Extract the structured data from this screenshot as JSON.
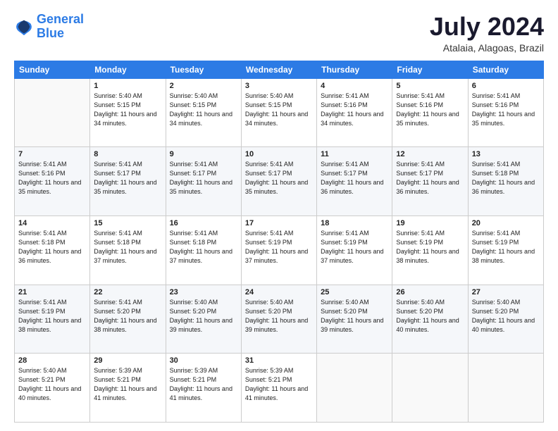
{
  "logo": {
    "line1": "General",
    "line2": "Blue"
  },
  "title": "July 2024",
  "subtitle": "Atalaia, Alagoas, Brazil",
  "days_of_week": [
    "Sunday",
    "Monday",
    "Tuesday",
    "Wednesday",
    "Thursday",
    "Friday",
    "Saturday"
  ],
  "weeks": [
    [
      {
        "day": "",
        "sunrise": "",
        "sunset": "",
        "daylight": ""
      },
      {
        "day": "1",
        "sunrise": "Sunrise: 5:40 AM",
        "sunset": "Sunset: 5:15 PM",
        "daylight": "Daylight: 11 hours and 34 minutes."
      },
      {
        "day": "2",
        "sunrise": "Sunrise: 5:40 AM",
        "sunset": "Sunset: 5:15 PM",
        "daylight": "Daylight: 11 hours and 34 minutes."
      },
      {
        "day": "3",
        "sunrise": "Sunrise: 5:40 AM",
        "sunset": "Sunset: 5:15 PM",
        "daylight": "Daylight: 11 hours and 34 minutes."
      },
      {
        "day": "4",
        "sunrise": "Sunrise: 5:41 AM",
        "sunset": "Sunset: 5:16 PM",
        "daylight": "Daylight: 11 hours and 34 minutes."
      },
      {
        "day": "5",
        "sunrise": "Sunrise: 5:41 AM",
        "sunset": "Sunset: 5:16 PM",
        "daylight": "Daylight: 11 hours and 35 minutes."
      },
      {
        "day": "6",
        "sunrise": "Sunrise: 5:41 AM",
        "sunset": "Sunset: 5:16 PM",
        "daylight": "Daylight: 11 hours and 35 minutes."
      }
    ],
    [
      {
        "day": "7",
        "sunrise": "Sunrise: 5:41 AM",
        "sunset": "Sunset: 5:16 PM",
        "daylight": "Daylight: 11 hours and 35 minutes."
      },
      {
        "day": "8",
        "sunrise": "Sunrise: 5:41 AM",
        "sunset": "Sunset: 5:17 PM",
        "daylight": "Daylight: 11 hours and 35 minutes."
      },
      {
        "day": "9",
        "sunrise": "Sunrise: 5:41 AM",
        "sunset": "Sunset: 5:17 PM",
        "daylight": "Daylight: 11 hours and 35 minutes."
      },
      {
        "day": "10",
        "sunrise": "Sunrise: 5:41 AM",
        "sunset": "Sunset: 5:17 PM",
        "daylight": "Daylight: 11 hours and 35 minutes."
      },
      {
        "day": "11",
        "sunrise": "Sunrise: 5:41 AM",
        "sunset": "Sunset: 5:17 PM",
        "daylight": "Daylight: 11 hours and 36 minutes."
      },
      {
        "day": "12",
        "sunrise": "Sunrise: 5:41 AM",
        "sunset": "Sunset: 5:17 PM",
        "daylight": "Daylight: 11 hours and 36 minutes."
      },
      {
        "day": "13",
        "sunrise": "Sunrise: 5:41 AM",
        "sunset": "Sunset: 5:18 PM",
        "daylight": "Daylight: 11 hours and 36 minutes."
      }
    ],
    [
      {
        "day": "14",
        "sunrise": "Sunrise: 5:41 AM",
        "sunset": "Sunset: 5:18 PM",
        "daylight": "Daylight: 11 hours and 36 minutes."
      },
      {
        "day": "15",
        "sunrise": "Sunrise: 5:41 AM",
        "sunset": "Sunset: 5:18 PM",
        "daylight": "Daylight: 11 hours and 37 minutes."
      },
      {
        "day": "16",
        "sunrise": "Sunrise: 5:41 AM",
        "sunset": "Sunset: 5:18 PM",
        "daylight": "Daylight: 11 hours and 37 minutes."
      },
      {
        "day": "17",
        "sunrise": "Sunrise: 5:41 AM",
        "sunset": "Sunset: 5:19 PM",
        "daylight": "Daylight: 11 hours and 37 minutes."
      },
      {
        "day": "18",
        "sunrise": "Sunrise: 5:41 AM",
        "sunset": "Sunset: 5:19 PM",
        "daylight": "Daylight: 11 hours and 37 minutes."
      },
      {
        "day": "19",
        "sunrise": "Sunrise: 5:41 AM",
        "sunset": "Sunset: 5:19 PM",
        "daylight": "Daylight: 11 hours and 38 minutes."
      },
      {
        "day": "20",
        "sunrise": "Sunrise: 5:41 AM",
        "sunset": "Sunset: 5:19 PM",
        "daylight": "Daylight: 11 hours and 38 minutes."
      }
    ],
    [
      {
        "day": "21",
        "sunrise": "Sunrise: 5:41 AM",
        "sunset": "Sunset: 5:19 PM",
        "daylight": "Daylight: 11 hours and 38 minutes."
      },
      {
        "day": "22",
        "sunrise": "Sunrise: 5:41 AM",
        "sunset": "Sunset: 5:20 PM",
        "daylight": "Daylight: 11 hours and 38 minutes."
      },
      {
        "day": "23",
        "sunrise": "Sunrise: 5:40 AM",
        "sunset": "Sunset: 5:20 PM",
        "daylight": "Daylight: 11 hours and 39 minutes."
      },
      {
        "day": "24",
        "sunrise": "Sunrise: 5:40 AM",
        "sunset": "Sunset: 5:20 PM",
        "daylight": "Daylight: 11 hours and 39 minutes."
      },
      {
        "day": "25",
        "sunrise": "Sunrise: 5:40 AM",
        "sunset": "Sunset: 5:20 PM",
        "daylight": "Daylight: 11 hours and 39 minutes."
      },
      {
        "day": "26",
        "sunrise": "Sunrise: 5:40 AM",
        "sunset": "Sunset: 5:20 PM",
        "daylight": "Daylight: 11 hours and 40 minutes."
      },
      {
        "day": "27",
        "sunrise": "Sunrise: 5:40 AM",
        "sunset": "Sunset: 5:20 PM",
        "daylight": "Daylight: 11 hours and 40 minutes."
      }
    ],
    [
      {
        "day": "28",
        "sunrise": "Sunrise: 5:40 AM",
        "sunset": "Sunset: 5:21 PM",
        "daylight": "Daylight: 11 hours and 40 minutes."
      },
      {
        "day": "29",
        "sunrise": "Sunrise: 5:39 AM",
        "sunset": "Sunset: 5:21 PM",
        "daylight": "Daylight: 11 hours and 41 minutes."
      },
      {
        "day": "30",
        "sunrise": "Sunrise: 5:39 AM",
        "sunset": "Sunset: 5:21 PM",
        "daylight": "Daylight: 11 hours and 41 minutes."
      },
      {
        "day": "31",
        "sunrise": "Sunrise: 5:39 AM",
        "sunset": "Sunset: 5:21 PM",
        "daylight": "Daylight: 11 hours and 41 minutes."
      },
      {
        "day": "",
        "sunrise": "",
        "sunset": "",
        "daylight": ""
      },
      {
        "day": "",
        "sunrise": "",
        "sunset": "",
        "daylight": ""
      },
      {
        "day": "",
        "sunrise": "",
        "sunset": "",
        "daylight": ""
      }
    ]
  ]
}
